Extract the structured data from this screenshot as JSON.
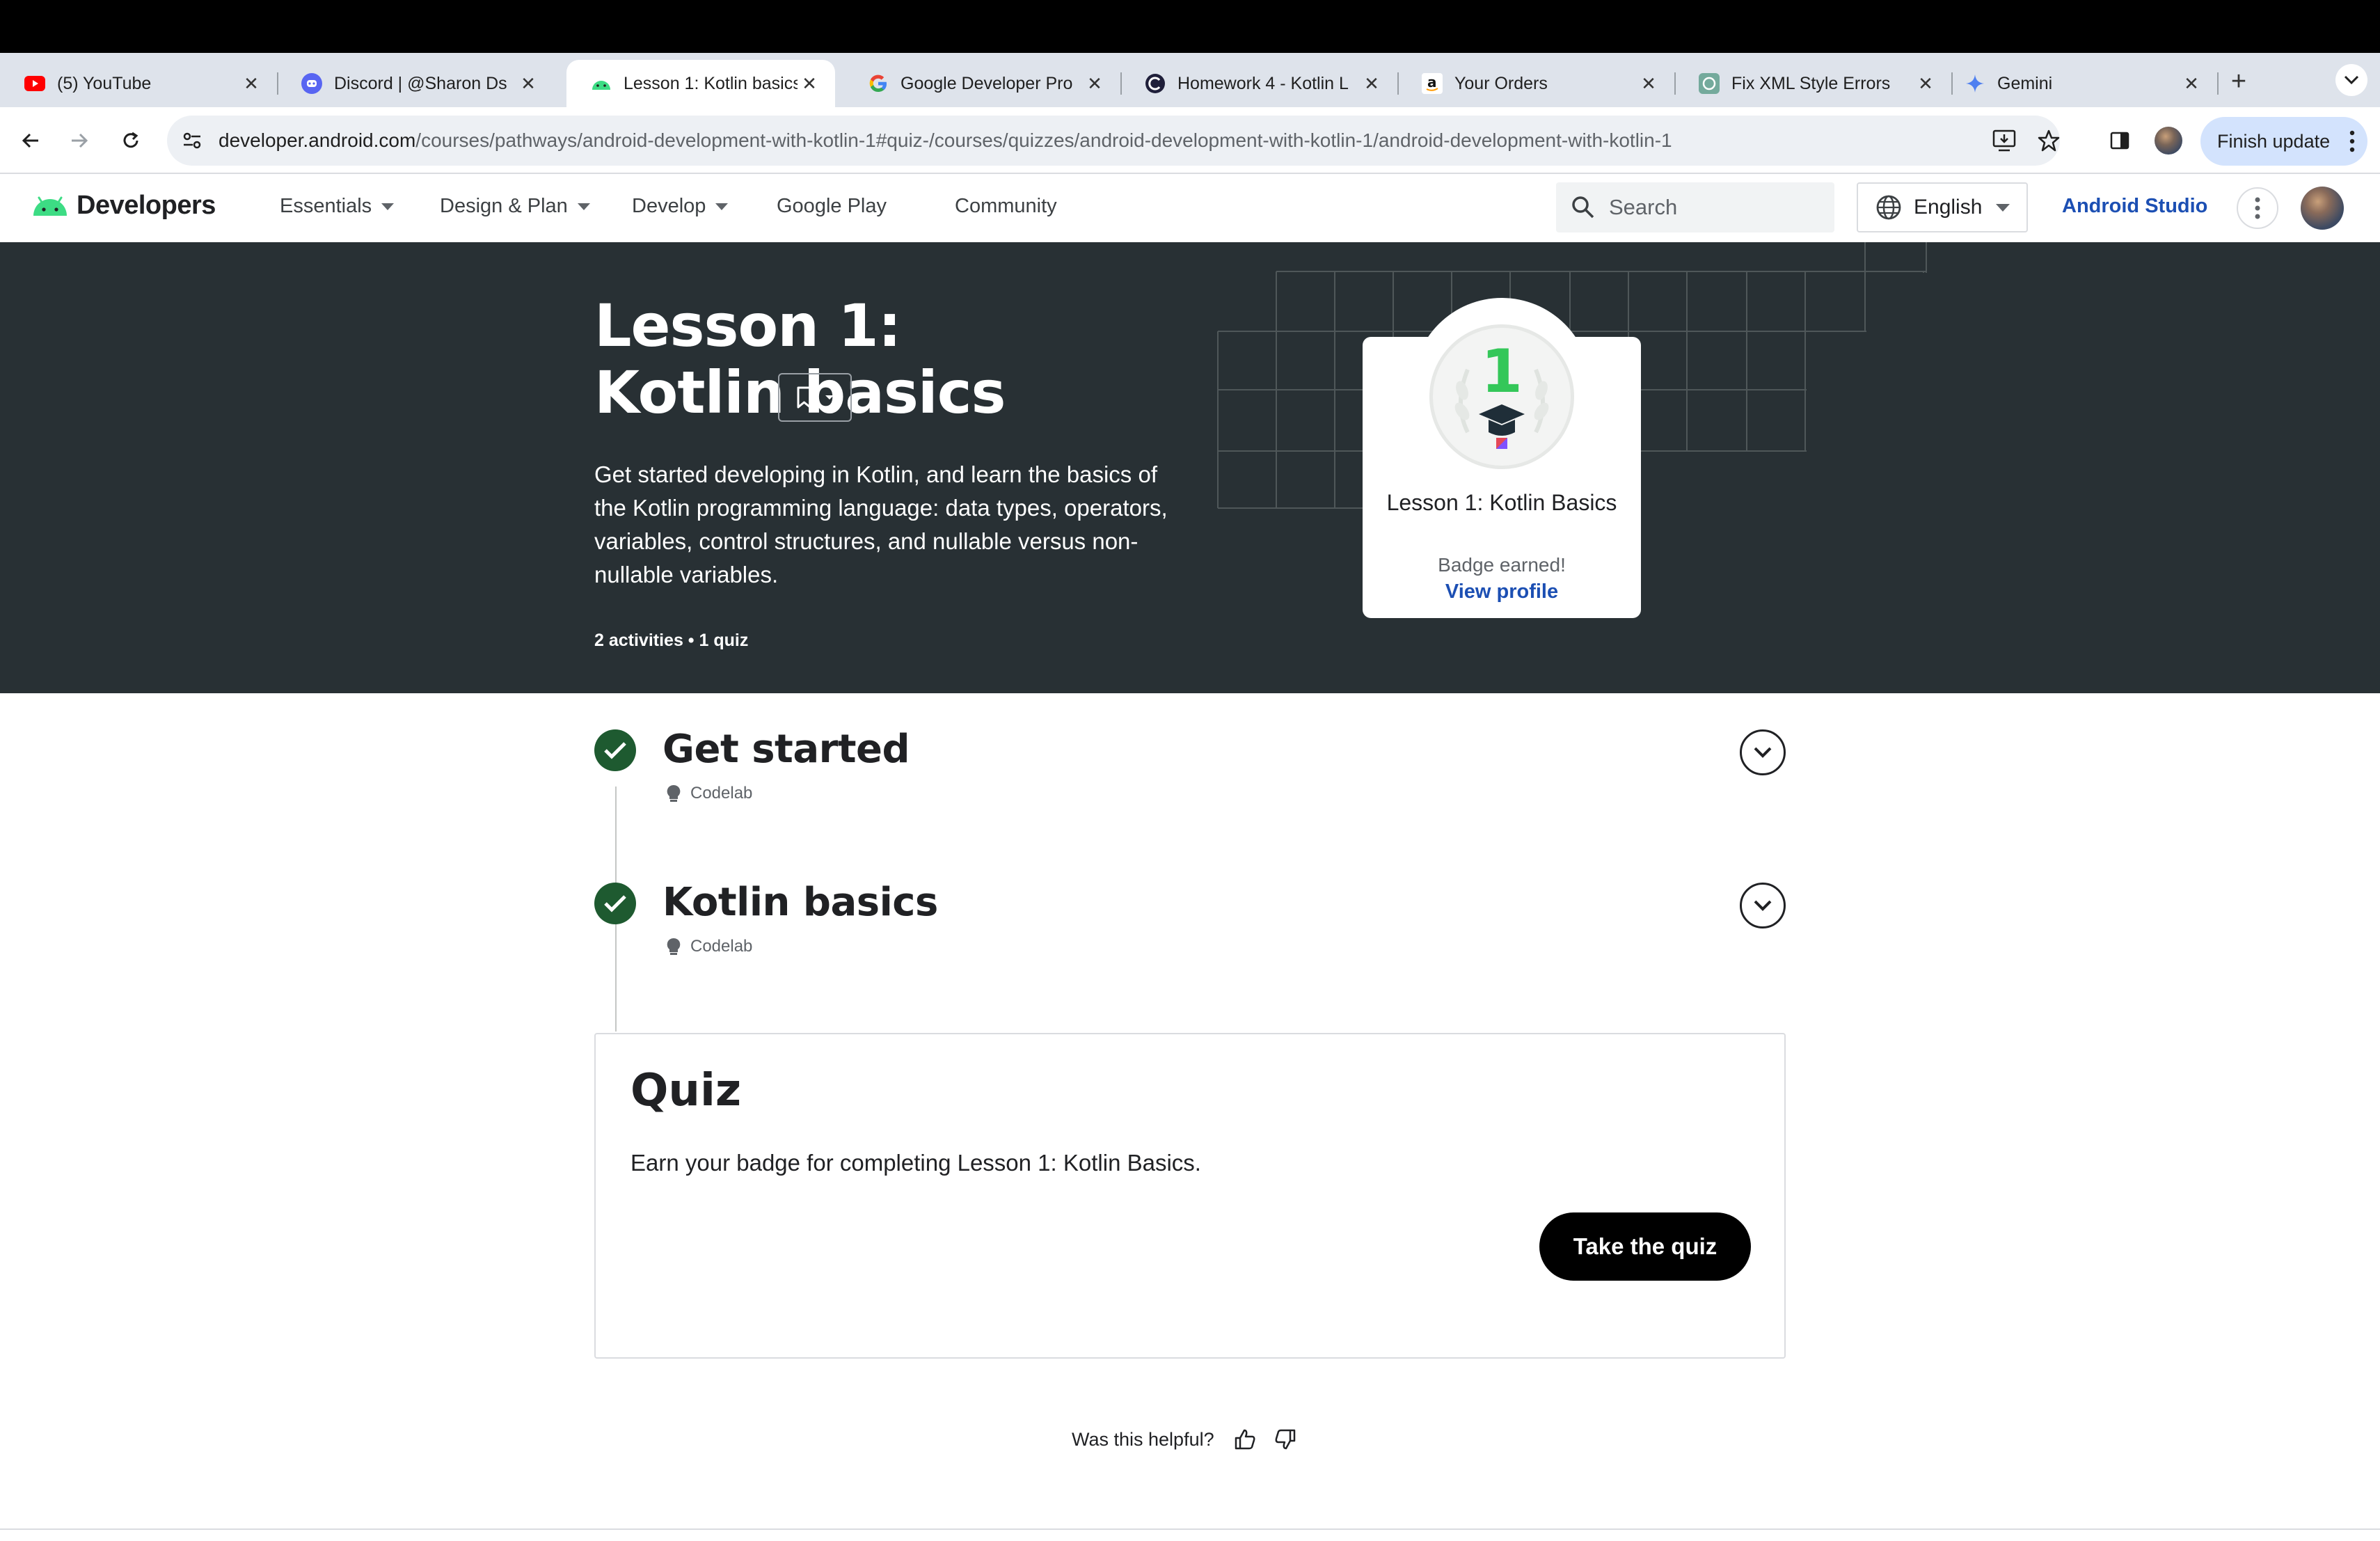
{
  "browser": {
    "tabs": [
      {
        "title": "(5) YouTube",
        "icon": "youtube-icon",
        "active": false
      },
      {
        "title": "Discord | @Sharon Ds",
        "icon": "discord-icon",
        "active": false
      },
      {
        "title": "Lesson 1: Kotlin basics",
        "icon": "android-icon",
        "active": true
      },
      {
        "title": "Google Developer Pro",
        "icon": "google-icon",
        "active": false
      },
      {
        "title": "Homework 4 - Kotlin L",
        "icon": "course-icon",
        "active": false
      },
      {
        "title": "Your Orders",
        "icon": "amazon-icon",
        "active": false
      },
      {
        "title": "Fix XML Style Errors",
        "icon": "chatgpt-icon",
        "active": false
      },
      {
        "title": "Gemini",
        "icon": "gemini-icon",
        "active": false
      }
    ],
    "close_glyph": "✕",
    "new_tab_glyph": "+",
    "url_domain": "developer.android.com",
    "url_path": "/courses/pathways/android-development-with-kotlin-1#quiz-/courses/quizzes/android-development-with-kotlin-1/android-development-with-kotlin-1",
    "finish_update_label": "Finish update"
  },
  "site_header": {
    "logo_text": "Developers",
    "nav": [
      {
        "label": "Essentials",
        "dropdown": true
      },
      {
        "label": "Design & Plan",
        "dropdown": true
      },
      {
        "label": "Develop",
        "dropdown": true
      },
      {
        "label": "Google Play",
        "dropdown": false
      },
      {
        "label": "Community",
        "dropdown": false
      }
    ],
    "search_placeholder": "Search",
    "language": "English",
    "android_studio_label": "Android Studio"
  },
  "hero": {
    "title": "Lesson 1: Kotlin basics",
    "description": "Get started developing in Kotlin, and learn the basics of the Kotlin programming language: data types, operators, variables, control structures, and nullable versus non-nullable variables.",
    "meta": "2 activities • 1 quiz",
    "badge": {
      "number": "1",
      "name": "Lesson 1: Kotlin Basics",
      "status": "Badge earned!",
      "profile_link": "View profile"
    }
  },
  "activities": [
    {
      "title": "Get started",
      "type": "Codelab",
      "completed": true
    },
    {
      "title": "Kotlin basics",
      "type": "Codelab",
      "completed": true
    }
  ],
  "quiz": {
    "heading": "Quiz",
    "description": "Earn your badge for completing Lesson 1: Kotlin Basics.",
    "button": "Take the quiz"
  },
  "feedback": {
    "question": "Was this helpful?"
  },
  "colors": {
    "hero_bg": "#283034",
    "check_green": "#1e5a30",
    "link_blue": "#1c4fb3",
    "badge_green": "#34c759"
  }
}
